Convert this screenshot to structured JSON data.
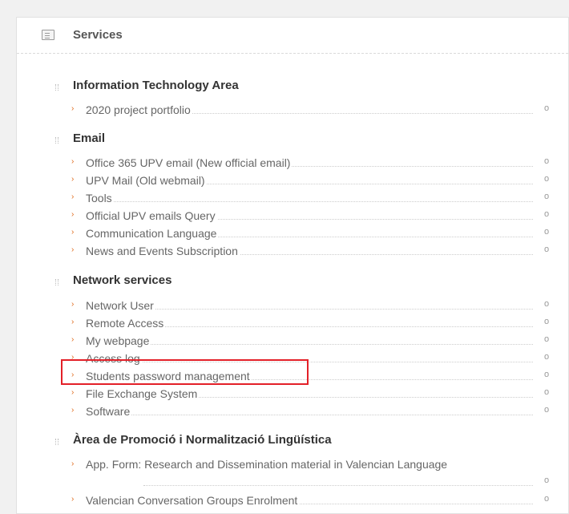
{
  "header": {
    "title": "Services",
    "icon": "list-icon"
  },
  "sections": [
    {
      "title": "Information Technology Area",
      "items": [
        {
          "label": "2020 project portfolio"
        }
      ]
    },
    {
      "title": "Email",
      "items": [
        {
          "label": "Office 365 UPV email (New official email)"
        },
        {
          "label": "UPV Mail (Old webmail)"
        },
        {
          "label": "Tools"
        },
        {
          "label": "Official UPV emails Query"
        },
        {
          "label": "Communication Language"
        },
        {
          "label": "News and Events Subscription"
        }
      ]
    },
    {
      "title": "Network services",
      "items": [
        {
          "label": "Network User"
        },
        {
          "label": "Remote Access"
        },
        {
          "label": "My webpage"
        },
        {
          "label": "Access log"
        },
        {
          "label": "Students password management",
          "highlighted": true
        },
        {
          "label": "File Exchange System"
        },
        {
          "label": "Software"
        }
      ]
    },
    {
      "title": "Àrea de Promoció i Normalització Lingüística",
      "items": [
        {
          "label": "App. Form: Research and Dissemination material in Valencian Language"
        },
        {
          "label": "Valencian Conversation Groups Enrolment"
        }
      ]
    }
  ],
  "highlight_color": "#e32028",
  "accent_color": "#e06a1b"
}
